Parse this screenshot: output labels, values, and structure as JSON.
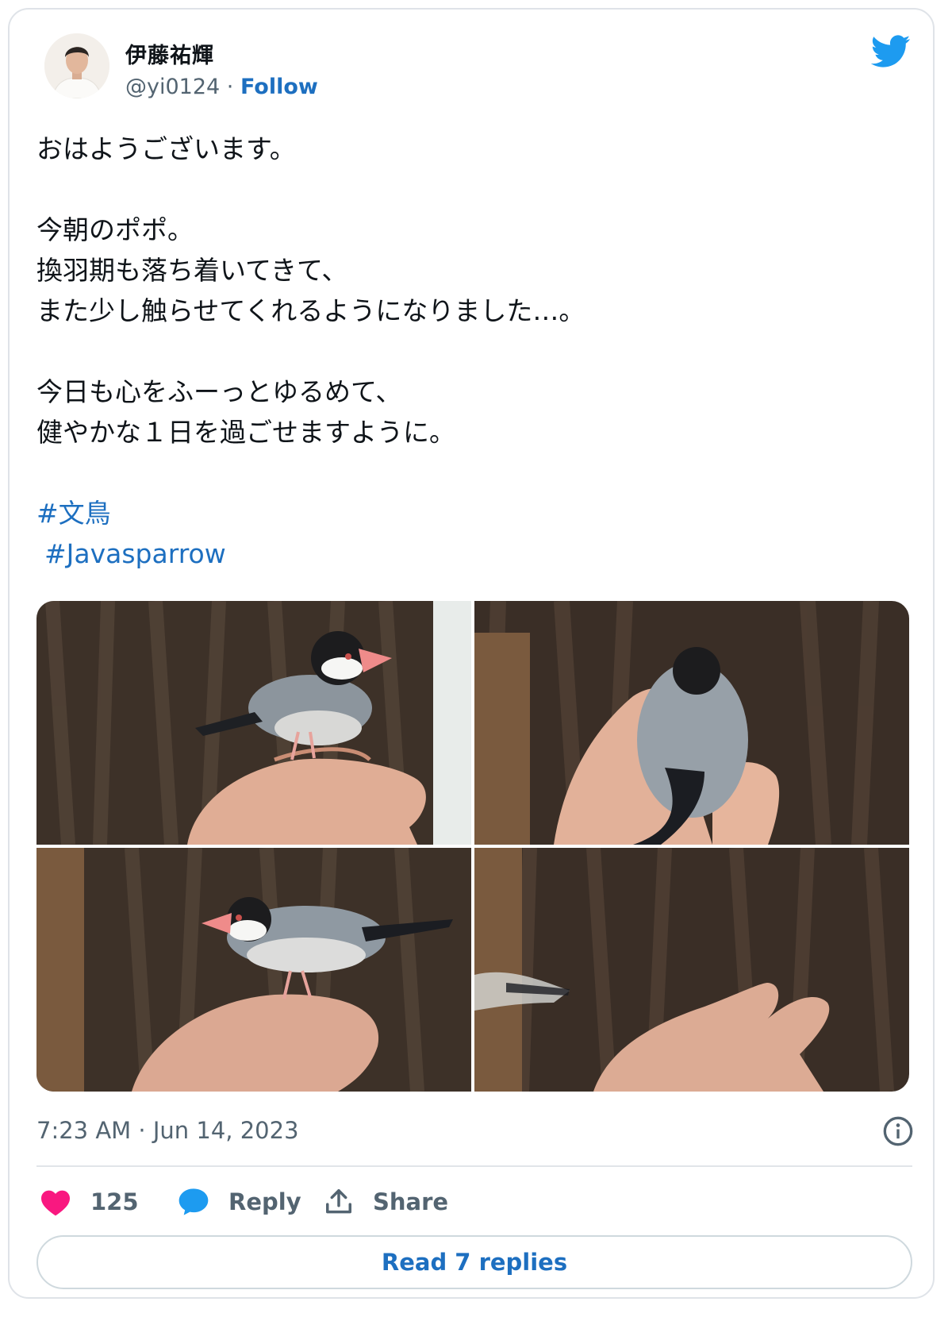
{
  "author": {
    "display_name": "伊藤祐輝",
    "handle": "@yi0124",
    "separator": " · ",
    "follow_label": "Follow"
  },
  "tweet": {
    "lines": [
      "おはようございます。",
      "",
      "今朝のポポ。",
      "換羽期も落ち着いてきて、",
      "また少し触らせてくれるようになりました…。",
      "",
      "今日も心をふーっとゆるめて、",
      "健やかな１日を過ごせますように。",
      ""
    ],
    "hashtags": [
      "#文鳥",
      "#Javasparrow"
    ]
  },
  "media": {
    "photos": [
      "java-sparrow-on-finger",
      "java-sparrow-back-in-hand",
      "java-sparrow-side-on-finger",
      "java-sparrow-flying-away"
    ]
  },
  "timestamp": "7:23 AM · Jun 14, 2023",
  "actions": {
    "like_count": "125",
    "reply_label": "Reply",
    "share_label": "Share"
  },
  "read_replies_label": "Read 7 replies",
  "colors": {
    "link": "#1d6fc0",
    "twitter_blue": "#1d9bf0",
    "like": "#f91880",
    "muted": "#536471"
  },
  "icons": [
    "twitter-bird-icon",
    "info-icon",
    "heart-icon",
    "reply-bubble-icon",
    "share-icon"
  ]
}
